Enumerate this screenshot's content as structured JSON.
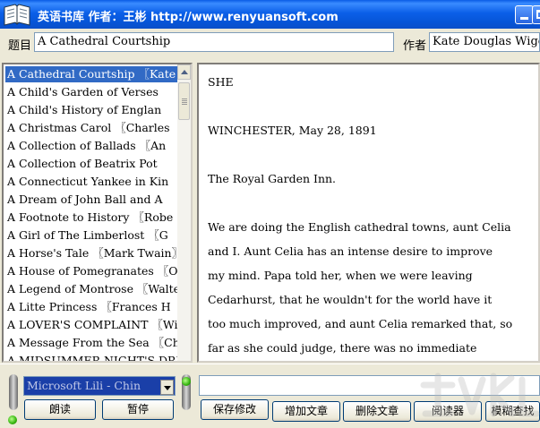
{
  "window": {
    "title": "英语书库  作者：王彬  http://www.renyuansoft.com"
  },
  "fields": {
    "title_label": "题目",
    "title_value": "A Cathedral Courtship",
    "author_label": "作者",
    "author_value": "Kate Douglas Wigg"
  },
  "books": [
    "A Cathedral Courtship 〖Kate",
    "A Child's Garden of Verses",
    "A Child's History of Englan",
    "A Christmas Carol 〖Charles",
    "A Collection of Ballads 〖An",
    "A Collection of Beatrix Pot",
    "A Connecticut Yankee in Kin",
    "A Dream of John Ball and A",
    "A Footnote to History 〖Robe",
    "A Girl of The Limberlost 〖G",
    "A Horse's Tale 〖Mark Twain〗",
    "A House of Pomegranates 〖Os",
    "A Legend of Montrose 〖Walte",
    "A Litte Princess 〖Frances H",
    "A LOVER'S COMPLAINT 〖Willia",
    "A Message From the Sea 〖Cha",
    "A MIDSUMMER NIGHT'S DREAM 〖"
  ],
  "selected_index": 0,
  "text_lines": [
    "SHE",
    "",
    "WINCHESTER, May 28, 1891",
    "",
    "The Royal Garden Inn.",
    "",
    "We are doing the English cathedral towns, aunt Celia",
    "and I.  Aunt Celia has an intense desire to improve",
    "my mind.  Papa told her, when we were leaving",
    "Cedarhurst, that he wouldn't for the world have it",
    "too much improved, and aunt Celia remarked that, so",
    "far as she could judge, there was no immediate"
  ],
  "voice": {
    "selected": "Microsoft Lili - Chin"
  },
  "buttons": {
    "read": "朗读",
    "pause": "暂停",
    "save": "保存修改",
    "add": "增加文章",
    "delete": "删除文章",
    "reader": "阅读器",
    "fuzzy_search": "模糊查找"
  },
  "colors": {
    "titlebar": "#0b5fe8",
    "selection": "#316ac5",
    "combo_bg": "#1a3fa8"
  }
}
